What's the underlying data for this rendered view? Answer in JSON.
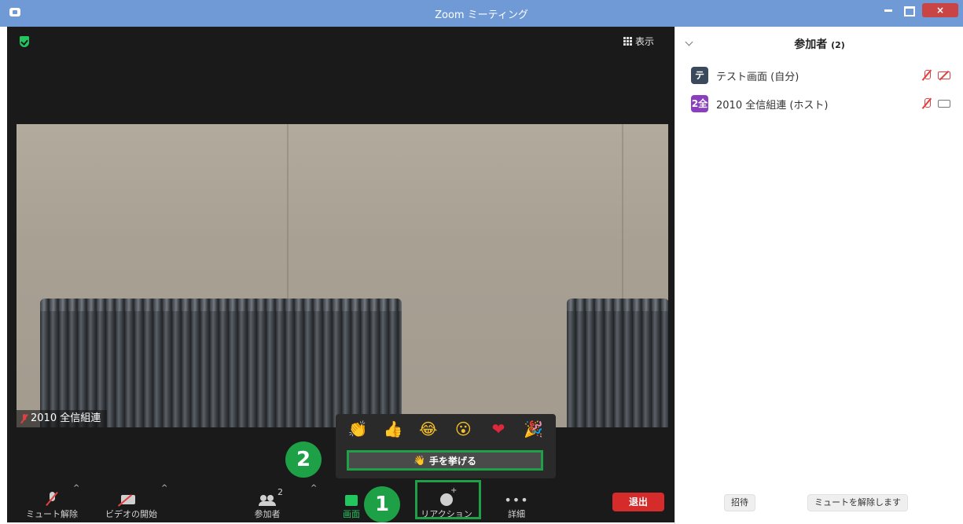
{
  "window": {
    "title": "Zoom ミーティング",
    "close_label": "×"
  },
  "meeting": {
    "view_label": "表示",
    "video_name": "2010 全信組連"
  },
  "reactions": {
    "emojis": [
      "👏",
      "👍",
      "😂",
      "😮",
      "❤",
      "🎉"
    ],
    "raise_hand_icon": "👋",
    "raise_hand_label": "手を挙げる"
  },
  "toolbar": {
    "unmute_label": "ミュート解除",
    "start_video_label": "ビデオの開始",
    "participants_label": "参加者",
    "participants_count": "2",
    "share_label": "画面",
    "reaction_label": "リアクション",
    "more_label": "詳細",
    "more_icon": "•••",
    "leave_label": "退出",
    "caret": "^"
  },
  "annotations": {
    "step1": "1",
    "step2": "2"
  },
  "panel": {
    "title": "参加者",
    "count": "(2)",
    "participants": [
      {
        "avatar": "テ",
        "name": "テスト画面 (自分)",
        "avatar_color": "#3a4a5c",
        "mic": "muted",
        "video": "off"
      },
      {
        "avatar": "2全",
        "name": "2010 全信組連 (ホスト)",
        "avatar_color": "#8b3fbf",
        "mic": "muted",
        "video": "on"
      }
    ],
    "invite_label": "招待",
    "unmute_all_label": "ミュートを解除します"
  },
  "colors": {
    "accent_green": "#1ea047",
    "leave_red": "#d52b2b",
    "titlebar": "#6f9ad6"
  }
}
